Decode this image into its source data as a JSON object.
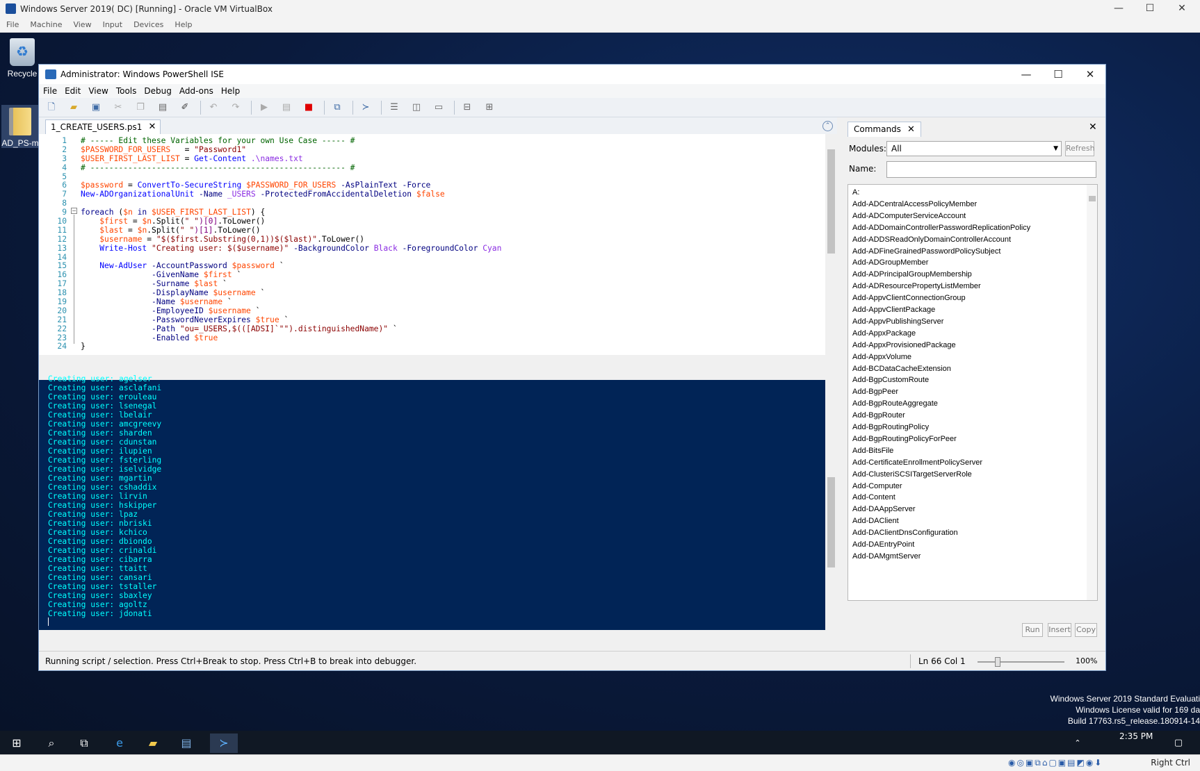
{
  "host": {
    "title": "Windows Server 2019( DC) [Running] - Oracle VM VirtualBox",
    "menu": [
      "File",
      "Machine",
      "View",
      "Input",
      "Devices",
      "Help"
    ],
    "status_key": "Right Ctrl"
  },
  "desktop": {
    "icons": [
      {
        "label": "Recycle"
      },
      {
        "label": "AD_PS-m"
      }
    ],
    "watermark": [
      "Windows Server 2019 Standard Evaluati",
      "Windows License valid for 169 da",
      "Build 17763.rs5_release.180914-14"
    ],
    "clock": "2:35 PM"
  },
  "ise": {
    "title": "Administrator: Windows PowerShell ISE",
    "menu": [
      "File",
      "Edit",
      "View",
      "Tools",
      "Debug",
      "Add-ons",
      "Help"
    ],
    "tab": "1_CREATE_USERS.ps1",
    "code_lines": [
      [
        {
          "t": "# ----- Edit these Variables for your own Use Case ----- #",
          "c": "cm"
        }
      ],
      [
        {
          "t": "$PASSWORD_FOR_USERS",
          "c": "var"
        },
        {
          "t": "   = ",
          "c": "tx"
        },
        {
          "t": "\"Password1\"",
          "c": "str"
        }
      ],
      [
        {
          "t": "$USER_FIRST_LAST_LIST",
          "c": "var"
        },
        {
          "t": " = ",
          "c": "tx"
        },
        {
          "t": "Get-Content",
          "c": "cmd"
        },
        {
          "t": " .\\names.txt",
          "c": "arg"
        }
      ],
      [
        {
          "t": "# ------------------------------------------------------ #",
          "c": "cm"
        }
      ],
      [],
      [
        {
          "t": "$password",
          "c": "var"
        },
        {
          "t": " = ",
          "c": "tx"
        },
        {
          "t": "ConvertTo-SecureString",
          "c": "cmd"
        },
        {
          "t": " ",
          "c": "tx"
        },
        {
          "t": "$PASSWORD_FOR_USERS",
          "c": "var"
        },
        {
          "t": " -AsPlainText -Force",
          "c": "par"
        }
      ],
      [
        {
          "t": "New-ADOrganizationalUnit",
          "c": "cmd"
        },
        {
          "t": " -Name ",
          "c": "par"
        },
        {
          "t": "_USERS",
          "c": "arg"
        },
        {
          "t": " -ProtectedFromAccidentalDeletion ",
          "c": "par"
        },
        {
          "t": "$false",
          "c": "var"
        }
      ],
      [],
      [
        {
          "t": "foreach",
          "c": "kw"
        },
        {
          "t": " (",
          "c": "tx"
        },
        {
          "t": "$n",
          "c": "var"
        },
        {
          "t": " in ",
          "c": "kw"
        },
        {
          "t": "$USER_FIRST_LAST_LIST",
          "c": "var"
        },
        {
          "t": ") {",
          "c": "tx"
        }
      ],
      [
        {
          "t": "    ",
          "c": "tx"
        },
        {
          "t": "$first",
          "c": "var"
        },
        {
          "t": " = ",
          "c": "tx"
        },
        {
          "t": "$n",
          "c": "var"
        },
        {
          "t": ".Split(",
          "c": "tx"
        },
        {
          "t": "\" \"",
          "c": "str"
        },
        {
          "t": ")[0]",
          "c": "num"
        },
        {
          "t": ".ToLower()",
          "c": "tx"
        }
      ],
      [
        {
          "t": "    ",
          "c": "tx"
        },
        {
          "t": "$last",
          "c": "var"
        },
        {
          "t": " = ",
          "c": "tx"
        },
        {
          "t": "$n",
          "c": "var"
        },
        {
          "t": ".Split(",
          "c": "tx"
        },
        {
          "t": "\" \"",
          "c": "str"
        },
        {
          "t": ")[1]",
          "c": "num"
        },
        {
          "t": ".ToLower()",
          "c": "tx"
        }
      ],
      [
        {
          "t": "    ",
          "c": "tx"
        },
        {
          "t": "$username",
          "c": "var"
        },
        {
          "t": " = ",
          "c": "tx"
        },
        {
          "t": "\"$($first.Substring(0,1))$($last)\"",
          "c": "str"
        },
        {
          "t": ".ToLower()",
          "c": "tx"
        }
      ],
      [
        {
          "t": "    ",
          "c": "tx"
        },
        {
          "t": "Write-Host",
          "c": "cmd"
        },
        {
          "t": " ",
          "c": "tx"
        },
        {
          "t": "\"Creating user: $($username)\"",
          "c": "str"
        },
        {
          "t": " -BackgroundColor ",
          "c": "par"
        },
        {
          "t": "Black",
          "c": "arg"
        },
        {
          "t": " -ForegroundColor ",
          "c": "par"
        },
        {
          "t": "Cyan",
          "c": "arg"
        }
      ],
      [],
      [
        {
          "t": "    ",
          "c": "tx"
        },
        {
          "t": "New-AdUser",
          "c": "cmd"
        },
        {
          "t": " -AccountPassword ",
          "c": "par"
        },
        {
          "t": "$password",
          "c": "var"
        },
        {
          "t": " `",
          "c": "tx"
        }
      ],
      [
        {
          "t": "               -GivenName ",
          "c": "par"
        },
        {
          "t": "$first",
          "c": "var"
        },
        {
          "t": " `",
          "c": "tx"
        }
      ],
      [
        {
          "t": "               -Surname ",
          "c": "par"
        },
        {
          "t": "$last",
          "c": "var"
        },
        {
          "t": " `",
          "c": "tx"
        }
      ],
      [
        {
          "t": "               -DisplayName ",
          "c": "par"
        },
        {
          "t": "$username",
          "c": "var"
        },
        {
          "t": " `",
          "c": "tx"
        }
      ],
      [
        {
          "t": "               -Name ",
          "c": "par"
        },
        {
          "t": "$username",
          "c": "var"
        },
        {
          "t": " `",
          "c": "tx"
        }
      ],
      [
        {
          "t": "               -EmployeeID ",
          "c": "par"
        },
        {
          "t": "$username",
          "c": "var"
        },
        {
          "t": " `",
          "c": "tx"
        }
      ],
      [
        {
          "t": "               -PasswordNeverExpires ",
          "c": "par"
        },
        {
          "t": "$true",
          "c": "var"
        },
        {
          "t": " `",
          "c": "tx"
        }
      ],
      [
        {
          "t": "               -Path ",
          "c": "par"
        },
        {
          "t": "\"ou=_USERS,$(([ADSI]`\"\").distinguishedName)\"",
          "c": "str"
        },
        {
          "t": " `",
          "c": "tx"
        }
      ],
      [
        {
          "t": "               -Enabled ",
          "c": "par"
        },
        {
          "t": "$true",
          "c": "var"
        }
      ],
      [
        {
          "t": "}",
          "c": "tx"
        }
      ]
    ],
    "console_prefix": "Creating user: ",
    "console_users": [
      "agelser",
      "asclafani",
      "erouleau",
      "lsenegal",
      "lbelair",
      "amcgreevy",
      "sharden",
      "cdunstan",
      "ilupien",
      "fsterling",
      "iselvidge",
      "mgartin",
      "cshaddix",
      "lirvin",
      "hskipper",
      "lpaz",
      "nbriski",
      "kchico",
      "dbiondo",
      "crinaldi",
      "cibarra",
      "ttaitt",
      "cansari",
      "tstaller",
      "sbaxley",
      "agoltz",
      "jdonati"
    ],
    "status": {
      "message": "Running script / selection.  Press Ctrl+Break to stop.  Press Ctrl+B to break into debugger.",
      "position": "Ln 66  Col 1",
      "zoom": "100%",
      "zoom_fraction": 0.2
    }
  },
  "commands": {
    "tab": "Commands",
    "modules_label": "Modules:",
    "modules_value": "All",
    "refresh": "Refresh",
    "name_label": "Name:",
    "name_value": "",
    "items": [
      "A:",
      "Add-ADCentralAccessPolicyMember",
      "Add-ADComputerServiceAccount",
      "Add-ADDomainControllerPasswordReplicationPolicy",
      "Add-ADDSReadOnlyDomainControllerAccount",
      "Add-ADFineGrainedPasswordPolicySubject",
      "Add-ADGroupMember",
      "Add-ADPrincipalGroupMembership",
      "Add-ADResourcePropertyListMember",
      "Add-AppvClientConnectionGroup",
      "Add-AppvClientPackage",
      "Add-AppvPublishingServer",
      "Add-AppxPackage",
      "Add-AppxProvisionedPackage",
      "Add-AppxVolume",
      "Add-BCDataCacheExtension",
      "Add-BgpCustomRoute",
      "Add-BgpPeer",
      "Add-BgpRouteAggregate",
      "Add-BgpRouter",
      "Add-BgpRoutingPolicy",
      "Add-BgpRoutingPolicyForPeer",
      "Add-BitsFile",
      "Add-CertificateEnrollmentPolicyServer",
      "Add-ClusteriSCSITargetServerRole",
      "Add-Computer",
      "Add-Content",
      "Add-DAAppServer",
      "Add-DAClient",
      "Add-DAClientDnsConfiguration",
      "Add-DAEntryPoint",
      "Add-DAMgmtServer"
    ],
    "buttons": [
      "Run",
      "Insert",
      "Copy"
    ]
  }
}
